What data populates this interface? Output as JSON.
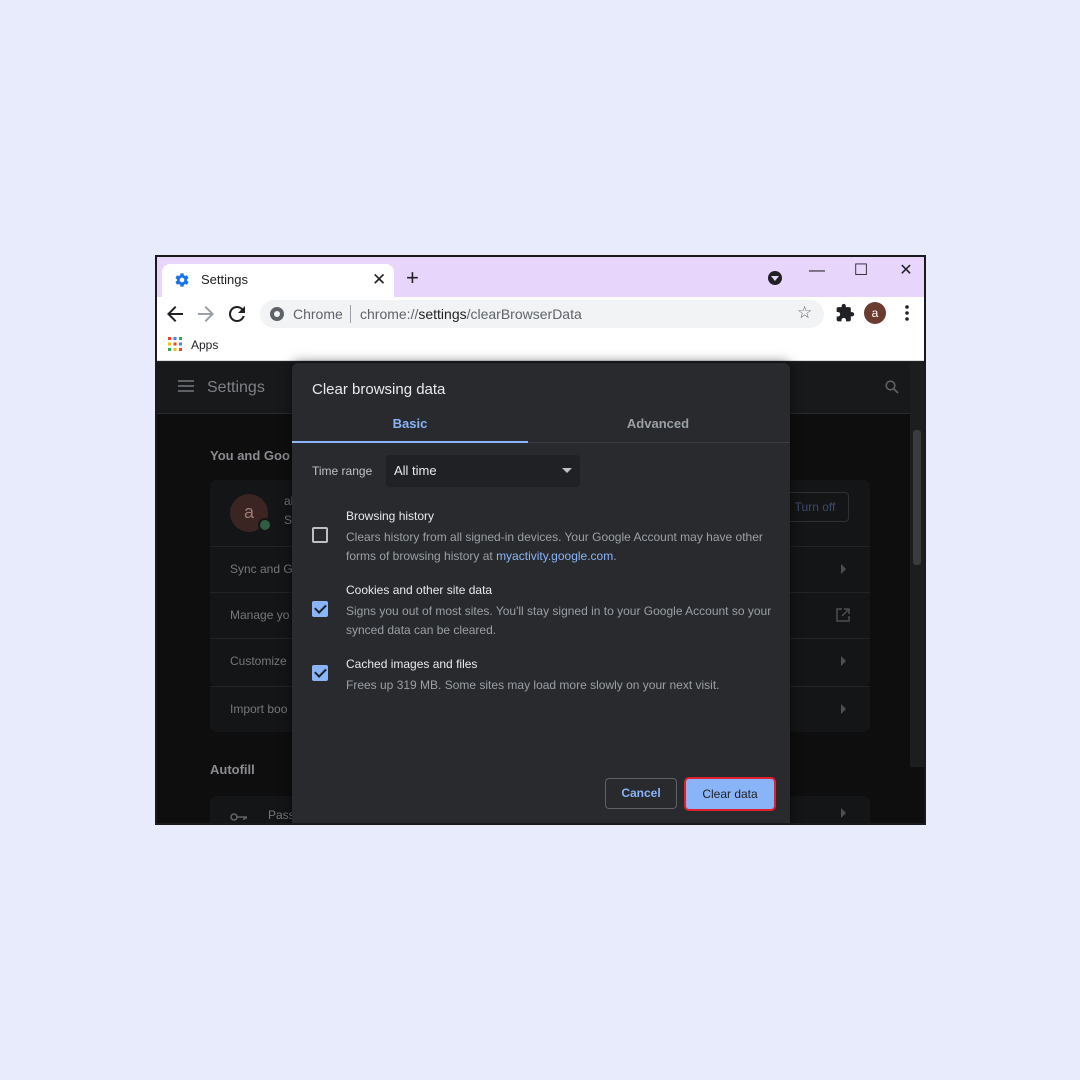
{
  "tab": {
    "title": "Settings",
    "close": "✕"
  },
  "newtab": "+",
  "window": {
    "minimize": "—",
    "maximize": "☐",
    "close": "✕"
  },
  "omnibox": {
    "chip": "Chrome",
    "url_prefix": "chrome://",
    "url_host": "settings",
    "url_path": "/clearBrowserData"
  },
  "profile": {
    "initial": "a"
  },
  "bookmarks": {
    "apps_label": "Apps"
  },
  "settings_page": {
    "title": "Settings",
    "section_you": "You and Goo",
    "account_line1": "al",
    "account_line2": "S",
    "turn_off": "Turn off",
    "rows": [
      "Sync and G",
      "Manage yo",
      "Customize",
      "Import boo"
    ],
    "section_autofill": "Autofill",
    "autofill_row": "Pass"
  },
  "dialog": {
    "title": "Clear browsing data",
    "tabs": {
      "basic": "Basic",
      "advanced": "Advanced"
    },
    "time_range_label": "Time range",
    "time_range_value": "All time",
    "options": [
      {
        "title": "Browsing history",
        "desc": "Clears history from all signed-in devices. Your Google Account may have other forms of browsing history at ",
        "link": "myactivity.google.com",
        "desc_end": ".",
        "checked": false
      },
      {
        "title": "Cookies and other site data",
        "desc": "Signs you out of most sites. You'll stay signed in to your Google Account so your synced data can be cleared.",
        "checked": true
      },
      {
        "title": "Cached images and files",
        "desc": "Frees up 319 MB. Some sites may load more slowly on your next visit.",
        "checked": true
      }
    ],
    "cancel_label": "Cancel",
    "clear_label": "Clear data"
  },
  "colors": {
    "accent": "#8ab4f8",
    "highlight": "#e0202c",
    "tabstrip": "#e7d5fb"
  }
}
